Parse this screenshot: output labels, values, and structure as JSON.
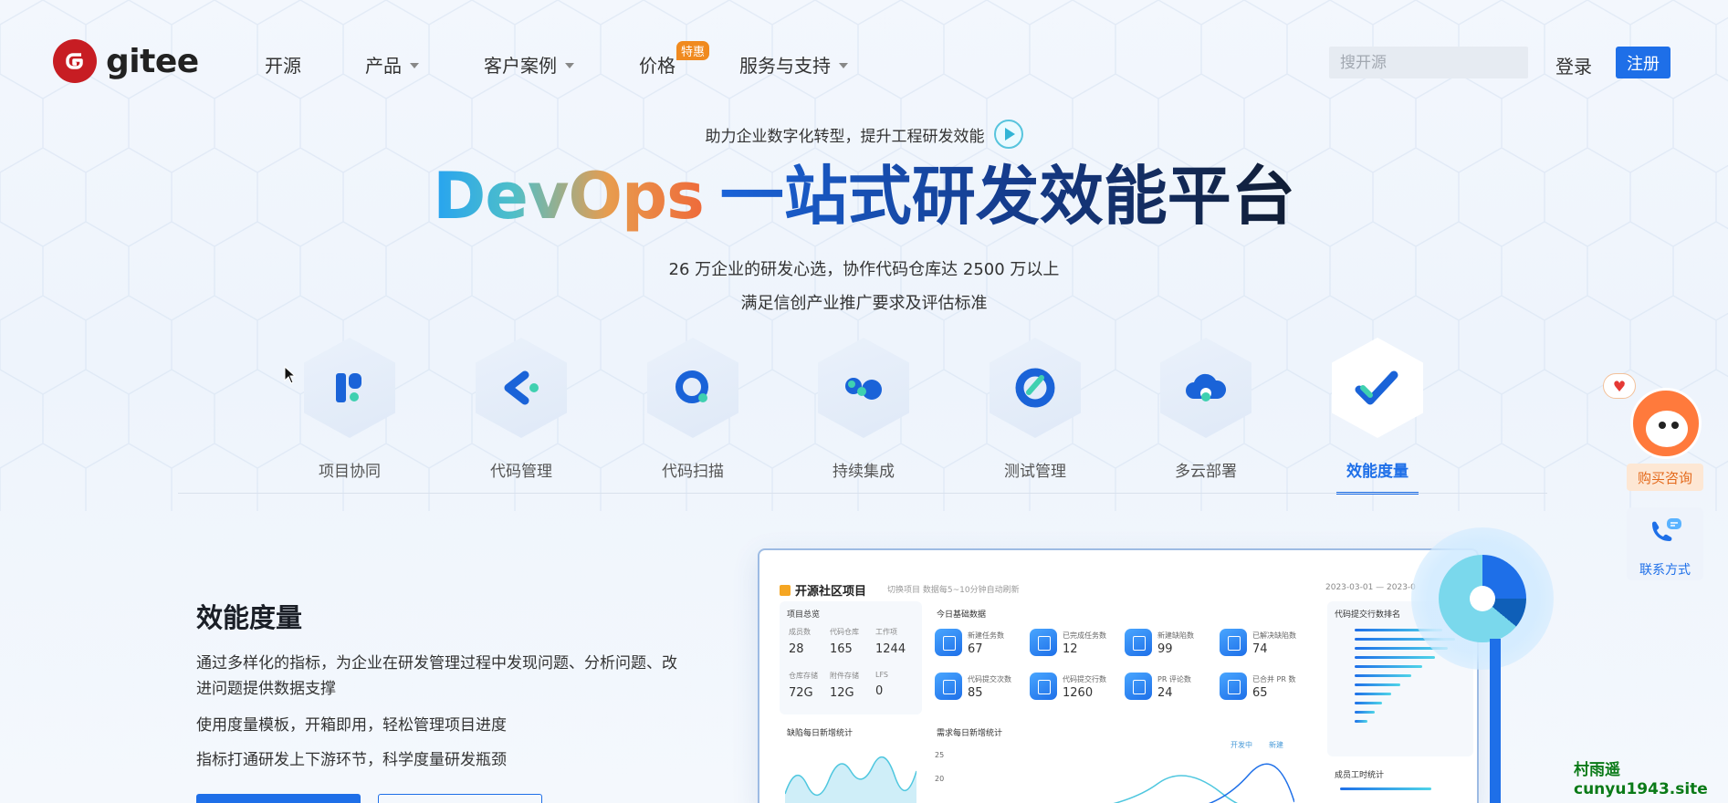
{
  "header": {
    "logo_text": "gitee",
    "nav": [
      {
        "label": "开源",
        "has_caret": false
      },
      {
        "label": "产品",
        "has_caret": true
      },
      {
        "label": "客户案例",
        "has_caret": true
      },
      {
        "label": "价格",
        "has_caret": false,
        "badge": "特惠"
      },
      {
        "label": "服务与支持",
        "has_caret": true
      }
    ],
    "search_placeholder": "搜开源",
    "login_label": "登录",
    "register_label": "注册"
  },
  "hero": {
    "tagline": "助力企业数字化转型，提升工程研发效能",
    "headline_brand": "DevOps",
    "headline_text": "一站式研发效能平台",
    "subtitle_line1": "26 万企业的研发心选，协作代码仓库达 2500 万以上",
    "subtitle_line2": "满足信创产业推广要求及评估标准"
  },
  "tabs": [
    {
      "label": "项目协同",
      "icon": "project-collab-icon",
      "active": false
    },
    {
      "label": "代码管理",
      "icon": "code-management-icon",
      "active": false
    },
    {
      "label": "代码扫描",
      "icon": "code-scan-icon",
      "active": false
    },
    {
      "label": "持续集成",
      "icon": "continuous-integration-icon",
      "active": false
    },
    {
      "label": "测试管理",
      "icon": "test-management-icon",
      "active": false
    },
    {
      "label": "多云部署",
      "icon": "multi-cloud-icon",
      "active": false
    },
    {
      "label": "效能度量",
      "icon": "efficiency-metrics-icon",
      "active": true
    }
  ],
  "feature": {
    "title": "效能度量",
    "description": "通过多样化的指标，为企业在研发管理过程中发现问题、分析问题、改进问题提供数据支撑",
    "point1": "使用度量模板，开箱即用，轻松管理项目进度",
    "point2": "指标打通研发上下游环节，科学度量研发瓶颈"
  },
  "dashboard": {
    "project_title": "开源社区项目",
    "toolbar_text": "切换项目   数据每5~10分钟自动刷新",
    "date_range": "2023-03-01   —   2023-0",
    "overview_title": "项目总览",
    "overview": [
      {
        "label": "成员数",
        "value": "28"
      },
      {
        "label": "代码仓库",
        "value": "165"
      },
      {
        "label": "工作项",
        "value": "1244"
      },
      {
        "label": "仓库存储",
        "value": "72G"
      },
      {
        "label": "附件存储",
        "value": "12G"
      },
      {
        "label": "LFS",
        "value": "0"
      }
    ],
    "today_title": "今日基础数据",
    "today": [
      {
        "label": "新建任务数",
        "value": "67"
      },
      {
        "label": "已完成任务数",
        "value": "12"
      },
      {
        "label": "新建缺陷数",
        "value": "99"
      },
      {
        "label": "已解决缺陷数",
        "value": "74"
      },
      {
        "label": "代码提交次数",
        "value": "85"
      },
      {
        "label": "代码提交行数",
        "value": "1260"
      },
      {
        "label": "PR 评论数",
        "value": "24"
      },
      {
        "label": "已合并 PR 数",
        "value": "65"
      }
    ],
    "rank_title": "代码提交行数排名",
    "bug_chart_title": "缺陷每日新增统计",
    "demand_chart_title": "需求每日新增统计",
    "legend": [
      "开发中",
      "新建"
    ],
    "member_chart_title": "成员工时统计",
    "y_ticks": [
      "25",
      "20"
    ]
  },
  "floating": {
    "consult_label": "购买咨询",
    "contact_label": "联系方式"
  },
  "watermark": {
    "line1": "村雨遥",
    "line2": "cunyu1943.site"
  },
  "colors": {
    "brand_red": "#c71d23",
    "primary_blue": "#1e6fe8",
    "consult_orange": "#e46a1c"
  }
}
